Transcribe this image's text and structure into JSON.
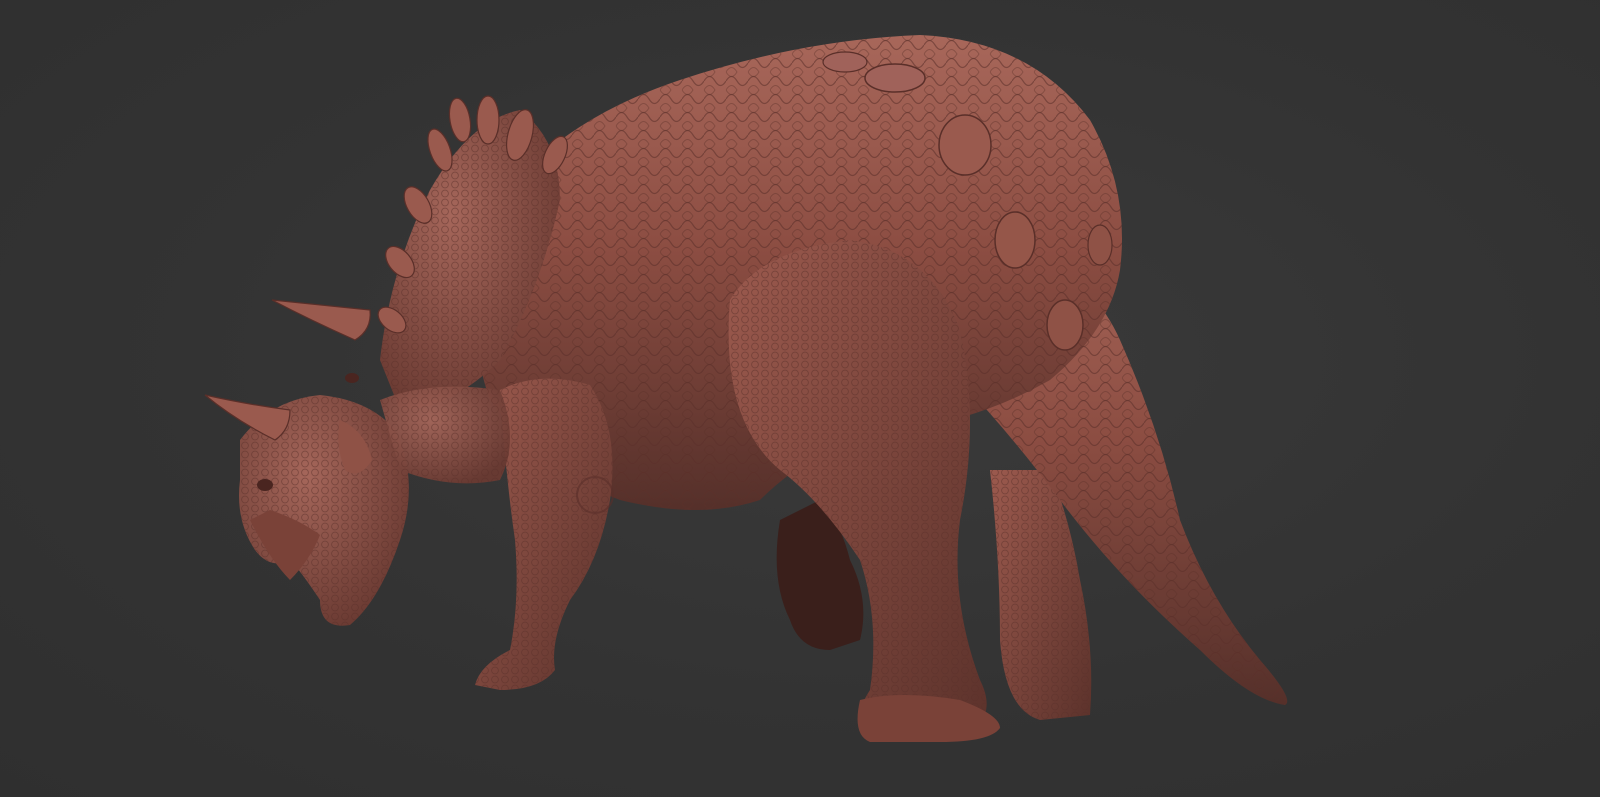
{
  "scene": {
    "subject": "dinosaur-sculpt",
    "background_color": "#333333",
    "material_color": "#8a4a40",
    "material_highlight": "#b06a5c",
    "material_shadow": "#4a2520"
  }
}
